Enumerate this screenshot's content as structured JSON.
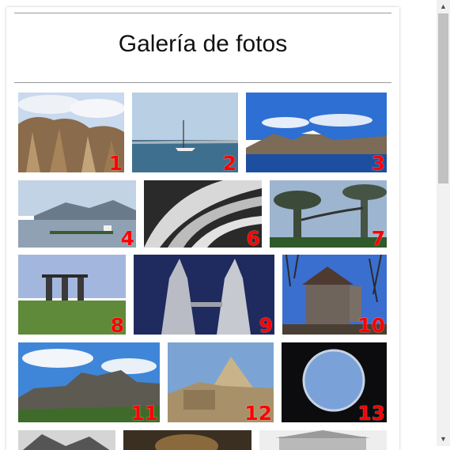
{
  "page": {
    "title": "Galería de fotos"
  },
  "photos": [
    {
      "num": "1",
      "scene": "fairy-chimneys"
    },
    {
      "num": "2",
      "scene": "sailboat"
    },
    {
      "num": "3",
      "scene": "mountain-lake"
    },
    {
      "num": "4",
      "scene": "lakeshore"
    },
    {
      "num": "6",
      "scene": "spiral-building"
    },
    {
      "num": "7",
      "scene": "supertrees"
    },
    {
      "num": "8",
      "scene": "marina-bay"
    },
    {
      "num": "9",
      "scene": "petronas-towers"
    },
    {
      "num": "10",
      "scene": "bran-castle"
    },
    {
      "num": "11",
      "scene": "hill-castle"
    },
    {
      "num": "12",
      "scene": "sphinx-pyramid"
    },
    {
      "num": "13",
      "scene": "porthole-night"
    },
    {
      "num": "",
      "scene": "partial-1"
    },
    {
      "num": "",
      "scene": "partial-2"
    },
    {
      "num": "",
      "scene": "partial-3"
    }
  ],
  "colors": {
    "number": "#ff0000",
    "divider": "#9a9a9a",
    "scrollbar_thumb": "#c1c1c1"
  },
  "icons": {
    "scroll_up": "triangle-up-icon",
    "scroll_down": "triangle-down-icon"
  }
}
